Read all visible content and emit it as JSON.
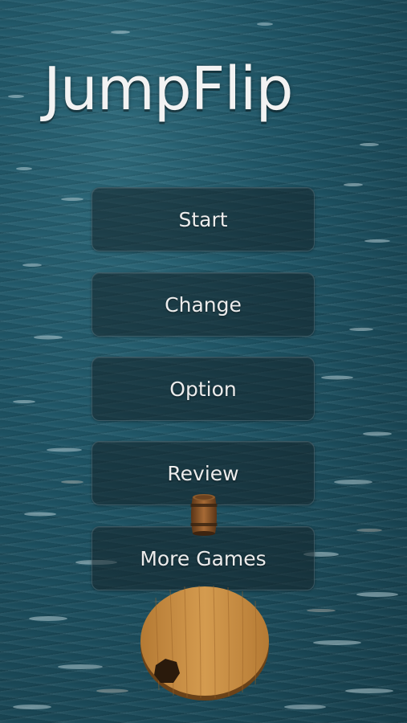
{
  "title": {
    "part1": "Jump",
    "part2": "Flip"
  },
  "menu": {
    "start_label": "Start",
    "change_label": "Change",
    "option_label": "Option",
    "review_label": "Review",
    "more_games_label": "More Games"
  },
  "scene": {
    "background": "ocean-water",
    "character": "barrel",
    "platform": "wooden-round-platform"
  },
  "colors": {
    "water": "#1f5566",
    "button_fill": "#142328",
    "title_text": "#f2f2f2",
    "wood": "#c98a3d"
  }
}
